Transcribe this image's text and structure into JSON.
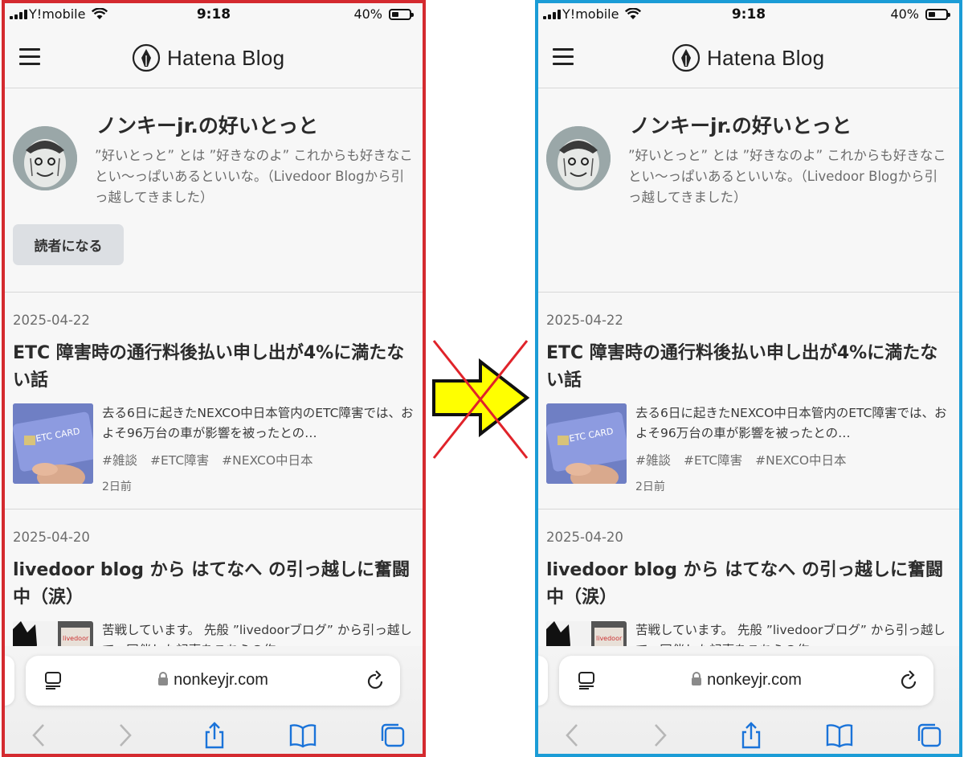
{
  "status": {
    "carrier": "Y!mobile",
    "time": "9:18",
    "battery": "40%"
  },
  "header": {
    "logo": "Hatena Blog"
  },
  "profile": {
    "title": "ノンキーjr.の好いとっと",
    "description": "”好いとっと” とは ”好きなのよ” これからも好きなことい〜っぱいあるといいな。（Livedoor Blogから引っ越してきました）",
    "subscribe": "読者になる"
  },
  "entries": [
    {
      "date": "2025-04-22",
      "title": "ETC 障害時の通行料後払い申し出が4%に満たない話",
      "excerpt": "去る6日に起きたNEXCO中日本管内のETC障害では、およそ96万台の車が影響を被ったとの…",
      "tags": [
        "#雑談",
        "#ETC障害",
        "#NEXCO中日本"
      ],
      "ago": "2日前",
      "thumb_text": "ETC CARD"
    },
    {
      "date": "2025-04-20",
      "title": "livedoor blog から はてなへ の引っ越しに奮闘中（涙）",
      "excerpt": "苦戦しています。 先般 ”livedoorブログ” から引っ越して、同伴した記事をこちらの作…"
    }
  ],
  "browser": {
    "url": "nonkeyjr.com"
  },
  "colors": {
    "left_frame": "#d42a2f",
    "right_frame": "#1b9cd6",
    "arrow_fill": "#ffff00",
    "cross": "#e0232a",
    "ios_blue": "#1a73d9"
  },
  "icons": [
    "hamburger-icon",
    "hatena-pen-icon",
    "reader-mode-icon",
    "lock-icon",
    "reload-icon",
    "back-icon",
    "forward-icon",
    "share-icon",
    "bookmarks-icon",
    "tabs-icon",
    "right-arrow-icon",
    "cross-mark-icon"
  ]
}
